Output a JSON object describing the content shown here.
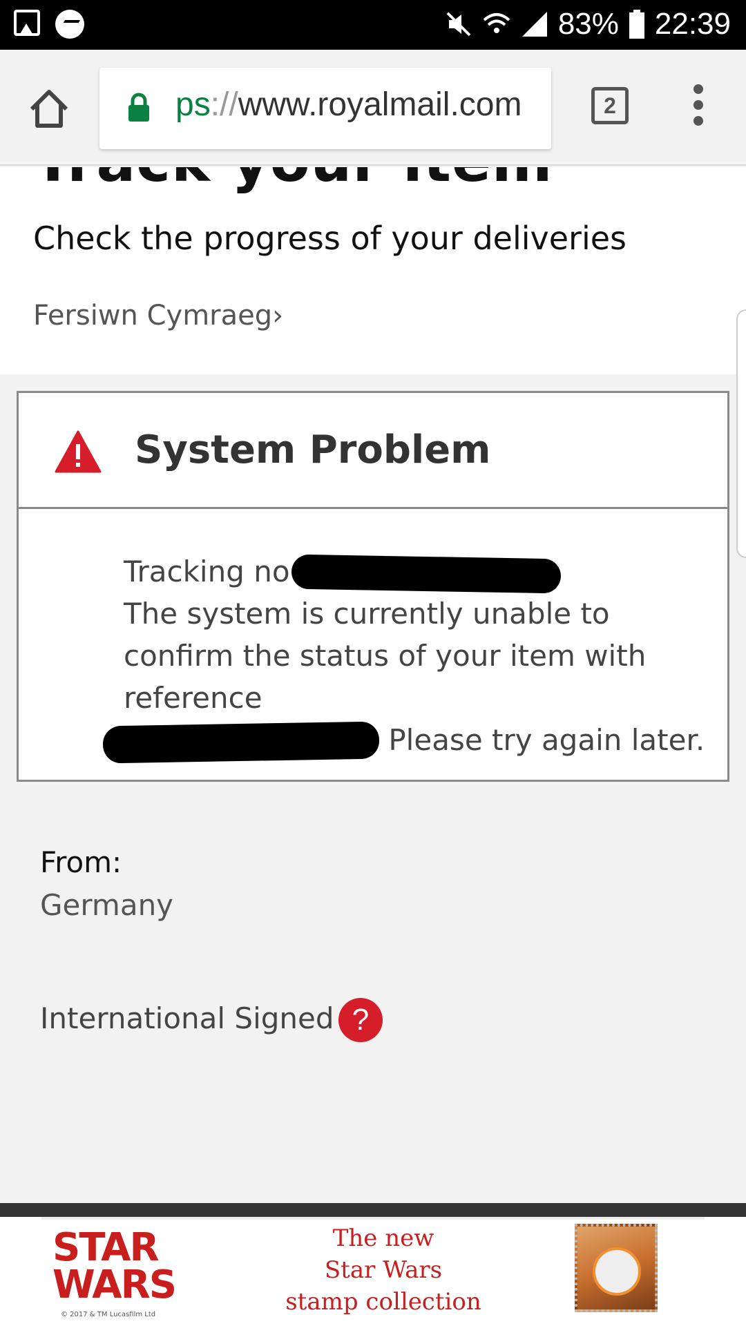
{
  "status_bar": {
    "battery": "83%",
    "time": "22:39",
    "icons": [
      "gallery-icon",
      "messenger-icon",
      "mute-icon",
      "wifi-icon",
      "signal-icon",
      "battery-icon"
    ]
  },
  "browser": {
    "url_scheme": "ps",
    "url_sep": "://",
    "url_host": "www.royalmail.com",
    "tab_count": "2"
  },
  "page": {
    "title": "Track your item",
    "subtitle": "Check the progress of your deliveries",
    "language_link": "Fersiwn Cymraeg",
    "language_chevron": "›"
  },
  "error": {
    "title": "System Problem",
    "tracking_label": "Tracking no",
    "message": "The system is currently unable to confirm the status of your item with reference",
    "message_end": "Please try again later."
  },
  "details": {
    "from_label": "From:",
    "from_value": "Germany",
    "service": "International Signed",
    "help_symbol": "?"
  },
  "ad": {
    "logo_line1": "STAR",
    "logo_line2": "WARS",
    "copyright": "© 2017 & TM Lucasfilm Ltd",
    "text_line1": "The new",
    "text_line2": "Star Wars",
    "text_line3": "stamp collection"
  },
  "colors": {
    "accent_red": "#d61d2a",
    "secure_green": "#0b8043",
    "page_bg": "#f2f2f2"
  }
}
